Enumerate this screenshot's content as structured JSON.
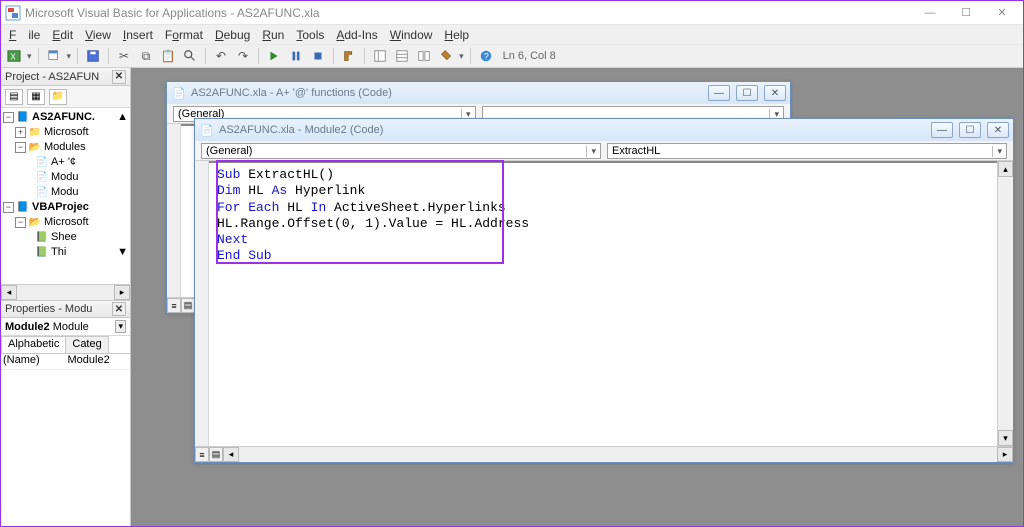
{
  "app": {
    "title": "Microsoft Visual Basic for Applications - AS2AFUNC.xla"
  },
  "menu": {
    "file": "File",
    "edit": "Edit",
    "view": "View",
    "insert": "Insert",
    "format": "Format",
    "debug": "Debug",
    "run": "Run",
    "tools": "Tools",
    "addins": "Add-Ins",
    "window": "Window",
    "help": "Help"
  },
  "toolbar": {
    "status": "Ln 6, Col 8"
  },
  "project_panel": {
    "title": "Project - AS2AFUN",
    "nodes": {
      "root1": "AS2AFUNC.",
      "ms1": "Microsoft",
      "mods": "Modules",
      "m1": "A+ '¢",
      "m2": "Modu",
      "m3": "Modu",
      "root2": "VBAProjec",
      "ms2": "Microsoft",
      "sheet": "Shee",
      "more": "Thi"
    }
  },
  "properties_panel": {
    "title": "Properties - Modu",
    "object_bold": "Module2",
    "object_type": "Module",
    "tab_alpha": "Alphabetic",
    "tab_cat": "Categ",
    "rows": [
      {
        "k": "(Name)",
        "v": "Module2"
      }
    ]
  },
  "code_window_back": {
    "title": "AS2AFUNC.xla - A+ '@' functions (Code)",
    "left_combo": "(General)"
  },
  "code_window_front": {
    "title": "AS2AFUNC.xla - Module2 (Code)",
    "left_combo": "(General)",
    "right_combo": "ExtractHL",
    "code": {
      "l1a": "Sub",
      "l1b": " ExtractHL()",
      "l2a": "Dim",
      "l2b": " HL ",
      "l2c": "As",
      "l2d": " Hyperlink",
      "l3a": "For Each",
      "l3b": " HL ",
      "l3c": "In",
      "l3d": " ActiveSheet.Hyperlinks",
      "l4": "HL.Range.Offset(0, 1).Value = HL.Address",
      "l5": "Next",
      "l6": "End Sub"
    }
  }
}
